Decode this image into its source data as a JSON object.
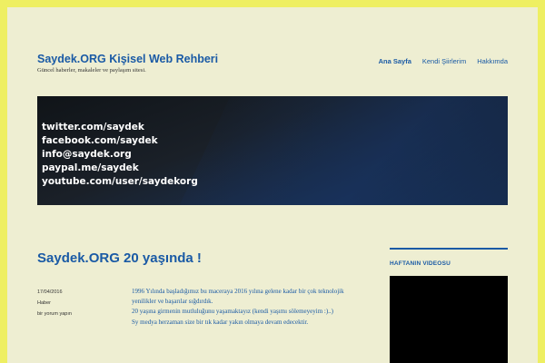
{
  "site": {
    "title": "Saydek.ORG Kişisel Web Rehberi",
    "description": "Güncel haberler, makaleler ve paylaşım sitesi."
  },
  "nav": {
    "items": [
      {
        "label": "Ana Sayfa",
        "active": true
      },
      {
        "label": "Kendi Şiirlerim",
        "active": false
      },
      {
        "label": "Hakkımda",
        "active": false
      }
    ]
  },
  "banner": {
    "lines": [
      "twitter.com/saydek",
      "facebook.com/saydek",
      "info@saydek.org",
      "paypal.me/saydek",
      "youtube.com/user/saydekorg"
    ]
  },
  "post": {
    "title": "Saydek.ORG 20 yaşında !",
    "date": "17/04/2016",
    "category": "Haber",
    "comments": "bir yorum yapın",
    "paragraphs": [
      "1996 Yılında başladığımız bu maceraya 2016 yılına gelene kadar bir çok teknolojik yenilikler ve başarılar sığdırdık.",
      "20 yaşına girmenin mutluluğunu yaşamaktayız (kendi yaşımı sölemeyeyim :)..)",
      "Sy medya herzaman size bir tık kadar yakın olmaya devam edecektir."
    ]
  },
  "sidebar": {
    "widget_title": "HAFTANIN VIDEOSU"
  },
  "colors": {
    "accent": "#1a5aa5",
    "frame": "#eeef62",
    "background": "#eeeed2"
  }
}
